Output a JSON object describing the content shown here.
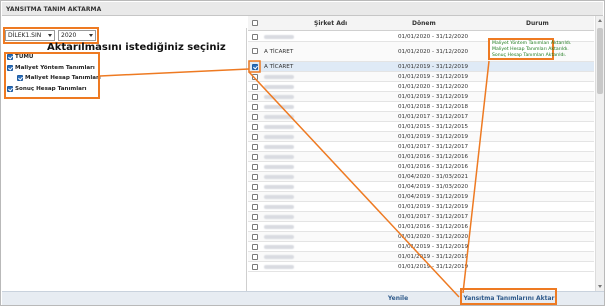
{
  "window": {
    "title": "YANSITMA TANIM AKTARMA"
  },
  "filters": {
    "branch_value": "DİLEK1.SIN",
    "year_value": "2020"
  },
  "left": {
    "heading": "Aktarılmasını istediğiniz seçiniz",
    "tree": [
      {
        "label": "TÜMÜ",
        "checked": true,
        "indent": 0
      },
      {
        "label": "Maliyet Yöntem Tanımları",
        "checked": true,
        "indent": 0
      },
      {
        "label": "Maliyet Hesap Tanımları",
        "checked": true,
        "indent": 1
      },
      {
        "label": "Sonuç Hesap Tanımları",
        "checked": true,
        "indent": 0
      }
    ]
  },
  "grid": {
    "columns": {
      "company": "Şirket Adı",
      "period": "Dönem",
      "status": "Durum"
    },
    "status_messages": [
      "Maliyet Yöntem Tanımları Aktarıldı.",
      "Maliyet Hesap Tanımları Aktarıldı.",
      "Sonuç Hesap Tanımları Aktarıldı."
    ],
    "rows": [
      {
        "company": "",
        "period": "01/01/2020 - 31/12/2020",
        "checked": false
      },
      {
        "company": "A TİCARET",
        "period": "01/01/2020 - 31/12/2020",
        "checked": false
      },
      {
        "company": "A TİCARET",
        "period": "01/01/2019 - 31/12/2019",
        "checked": true
      },
      {
        "company": "",
        "period": "01/01/2019 - 31/12/2019",
        "checked": false
      },
      {
        "company": "",
        "period": "01/01/2020 - 31/12/2020",
        "checked": false
      },
      {
        "company": "",
        "period": "01/01/2019 - 31/12/2019",
        "checked": false
      },
      {
        "company": "",
        "period": "01/01/2018 - 31/12/2018",
        "checked": false
      },
      {
        "company": "",
        "period": "01/01/2017 - 31/12/2017",
        "checked": false
      },
      {
        "company": "",
        "period": "01/01/2015 - 31/12/2015",
        "checked": false
      },
      {
        "company": "",
        "period": "01/01/2019 - 31/12/2019",
        "checked": false
      },
      {
        "company": "",
        "period": "01/01/2017 - 31/12/2017",
        "checked": false
      },
      {
        "company": "",
        "period": "01/01/2016 - 31/12/2016",
        "checked": false
      },
      {
        "company": "",
        "period": "01/01/2016 - 31/12/2016",
        "checked": false
      },
      {
        "company": "",
        "period": "01/04/2020 - 31/03/2021",
        "checked": false
      },
      {
        "company": "",
        "period": "01/04/2019 - 31/03/2020",
        "checked": false
      },
      {
        "company": "",
        "period": "01/04/2019 - 31/12/2019",
        "checked": false
      },
      {
        "company": "",
        "period": "01/01/2019 - 31/12/2019",
        "checked": false
      },
      {
        "company": "",
        "period": "01/01/2017 - 31/12/2017",
        "checked": false
      },
      {
        "company": "",
        "period": "01/01/2016 - 31/12/2016",
        "checked": false
      },
      {
        "company": "",
        "period": "01/01/2020 - 31/12/2020",
        "checked": false
      },
      {
        "company": "",
        "period": "01/01/2019 - 31/12/2019",
        "checked": false
      },
      {
        "company": "",
        "period": "01/01/2019 - 31/12/2019",
        "checked": false
      },
      {
        "company": "",
        "period": "01/01/2019 - 31/12/2019",
        "checked": false
      }
    ]
  },
  "footer": {
    "refresh_label": "Yenile",
    "transfer_label": "Yansıtma Tanımlarını Aktar"
  },
  "colors": {
    "highlight": "#ee7a22",
    "status_text": "#1c7a1c",
    "footer_text": "#2f5a8b"
  }
}
